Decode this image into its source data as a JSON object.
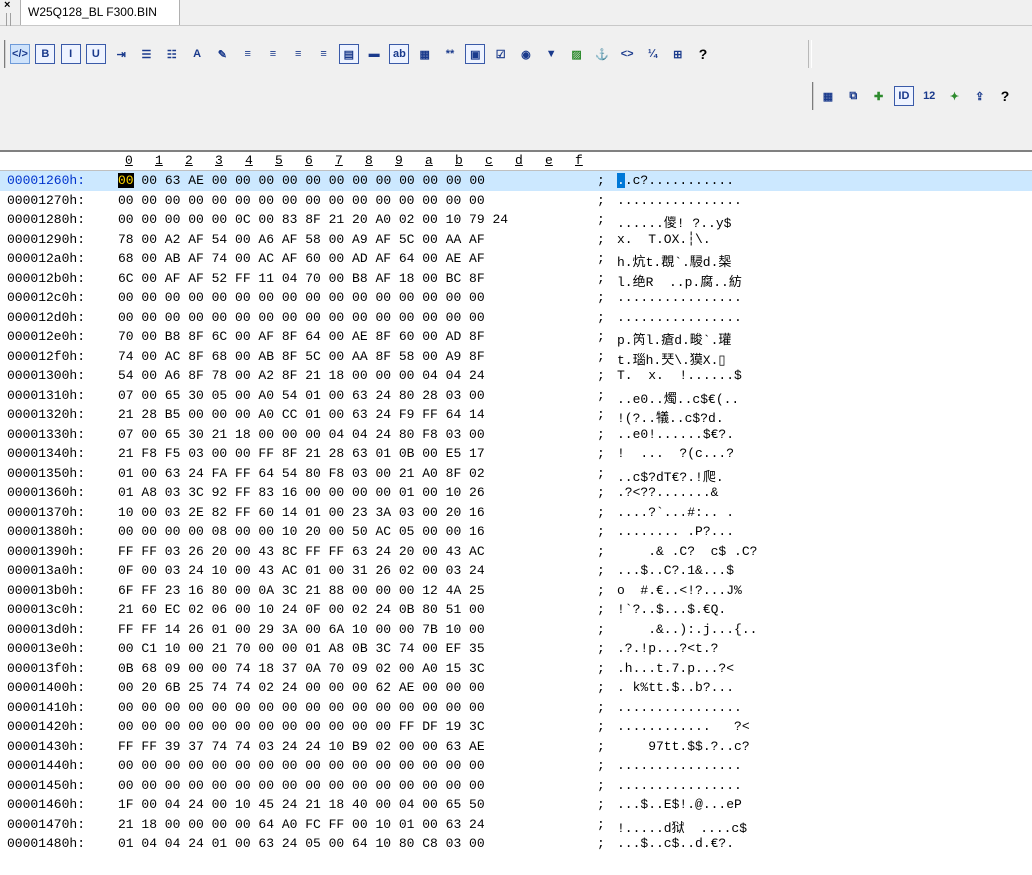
{
  "tab": {
    "close_glyph": "×",
    "title": "W25Q128_BL F300.BIN"
  },
  "toolbar1": [
    "source-view-icon",
    "bold-icon",
    "italic-icon",
    "underline-icon",
    "indent-icon",
    "bullet-list-icon",
    "numbered-list-icon",
    "font-color-icon",
    "highlight-icon",
    "align-left-icon",
    "align-center-icon",
    "align-right-icon",
    "justify-icon",
    "form-icon",
    "horizontal-rule-icon",
    "text-field-icon",
    "text-area-icon",
    "password-field-icon",
    "button-icon",
    "checkbox-icon",
    "radio-icon",
    "select-icon",
    "image-icon",
    "anchor-icon",
    "special-char-icon",
    "entity-icon",
    "table-icon",
    "help-icon"
  ],
  "toolbar1_help": "?",
  "toolbar2": [
    "table-grid-icon",
    "copy-icon",
    "insert-icon",
    "id-icon",
    "number-icon",
    "tools-icon",
    "export-icon",
    "help-icon"
  ],
  "toolbar2_help": "?",
  "column_header": [
    "0",
    "1",
    "2",
    "3",
    "4",
    "5",
    "6",
    "7",
    "8",
    "9",
    "a",
    "b",
    "c",
    "d",
    "e",
    "f"
  ],
  "cursor": {
    "row": 0,
    "byte": 0
  },
  "rows": [
    {
      "addr": "00001260h:",
      "bytes": "00 00 63 AE 00 00 00 00 00 00 00 00 00 00 00 00",
      "ascii": "..c?..........."
    },
    {
      "addr": "00001270h:",
      "bytes": "00 00 00 00 00 00 00 00 00 00 00 00 00 00 00 00",
      "ascii": "................"
    },
    {
      "addr": "00001280h:",
      "bytes": "00 00 00 00 00 0C 00 83 8F 21 20 A0 02 00 10 79 24",
      "ascii": "......儍! ?..y$"
    },
    {
      "addr": "00001290h:",
      "bytes": "78 00 A2 AF 54 00 A6 AF 58 00 A9 AF 5C 00 AA AF",
      "ascii": "x.  T.OX.┆\\."
    },
    {
      "addr": "000012a0h:",
      "bytes": "68 00 AB AF 74 00 AC AF 60 00 AD AF 64 00 AE AF",
      "ascii": "h.炕t.覠`.駸d.椝"
    },
    {
      "addr": "000012b0h:",
      "bytes": "6C 00 AF AF 52 FF 11 04 70 00 B8 AF 18 00 BC 8F",
      "ascii": "l.绝R  ..p.腐..紡"
    },
    {
      "addr": "000012c0h:",
      "bytes": "00 00 00 00 00 00 00 00 00 00 00 00 00 00 00 00",
      "ascii": "................"
    },
    {
      "addr": "000012d0h:",
      "bytes": "00 00 00 00 00 00 00 00 00 00 00 00 00 00 00 00",
      "ascii": "................"
    },
    {
      "addr": "000012e0h:",
      "bytes": "70 00 B8 8F 6C 00 AF 8F 64 00 AE 8F 60 00 AD 8F",
      "ascii": "p.笍l.瘡d.畯`.瓘"
    },
    {
      "addr": "000012f0h:",
      "bytes": "74 00 AC 8F 68 00 AB 8F 5C 00 AA 8F 58 00 A9 8F",
      "ascii": "t.瑙h.珡\\.獏X.▯"
    },
    {
      "addr": "00001300h:",
      "bytes": "54 00 A6 8F 78 00 A2 8F 21 18 00 00 00 04 04 24",
      "ascii": "T.  x.  !......$"
    },
    {
      "addr": "00001310h:",
      "bytes": "07 00 65 30 05 00 A0 54 01 00 63 24 80 28 03 00",
      "ascii": "..e0..燭..c$€(.."
    },
    {
      "addr": "00001320h:",
      "bytes": "21 28 B5 00 00 00 A0 CC 01 00 63 24 F9 FF 64 14",
      "ascii": "!(?..犠..c$?d."
    },
    {
      "addr": "00001330h:",
      "bytes": "07 00 65 30 21 18 00 00 00 04 04 24 80 F8 03 00",
      "ascii": "..e0!......$€?."
    },
    {
      "addr": "00001340h:",
      "bytes": "21 F8 F5 03 00 00 FF 8F 21 28 63 01 0B 00 E5 17",
      "ascii": "!  ...  ?(c...?"
    },
    {
      "addr": "00001350h:",
      "bytes": "01 00 63 24 FA FF 64 54 80 F8 03 00 21 A0 8F 02",
      "ascii": "..c$?dT€?.!爬."
    },
    {
      "addr": "00001360h:",
      "bytes": "01 A8 03 3C 92 FF 83 16 00 00 00 00 01 00 10 26",
      "ascii": ".?<??.......&"
    },
    {
      "addr": "00001370h:",
      "bytes": "10 00 03 2E 82 FF 60 14 01 00 23 3A 03 00 20 16",
      "ascii": "....?`...#:.. ."
    },
    {
      "addr": "00001380h:",
      "bytes": "00 00 00 00 08 00 00 10 20 00 50 AC 05 00 00 16",
      "ascii": "........ .P?..."
    },
    {
      "addr": "00001390h:",
      "bytes": "FF FF 03 26 20 00 43 8C FF FF 63 24 20 00 43 AC",
      "ascii": "    .& .C?  c$ .C?"
    },
    {
      "addr": "000013a0h:",
      "bytes": "0F 00 03 24 10 00 43 AC 01 00 31 26 02 00 03 24",
      "ascii": "...$..C?.1&...$"
    },
    {
      "addr": "000013b0h:",
      "bytes": "6F FF 23 16 80 00 0A 3C 21 88 00 00 00 12 4A 25",
      "ascii": "o  #.€..<!?...J%"
    },
    {
      "addr": "000013c0h:",
      "bytes": "21 60 EC 02 06 00 10 24 0F 00 02 24 0B 80 51 00",
      "ascii": "!`?..$...$.€Q."
    },
    {
      "addr": "000013d0h:",
      "bytes": "FF FF 14 26 01 00 29 3A 00 6A 10 00 00 7B 10 00",
      "ascii": "    .&..):.j...{.."
    },
    {
      "addr": "000013e0h:",
      "bytes": "00 C1 10 00 21 70 00 00 01 A8 0B 3C 74 00 EF 35",
      "ascii": ".?.!p...?<t.?"
    },
    {
      "addr": "000013f0h:",
      "bytes": "0B 68 09 00 00 74 18 37 0A 70 09 02 00 A0 15 3C",
      "ascii": ".h...t.7.p...?<"
    },
    {
      "addr": "00001400h:",
      "bytes": "00 20 6B 25 74 74 02 24 00 00 00 62 AE 00 00 00",
      "ascii": ". k%tt.$..b?..."
    },
    {
      "addr": "00001410h:",
      "bytes": "00 00 00 00 00 00 00 00 00 00 00 00 00 00 00 00",
      "ascii": "................"
    },
    {
      "addr": "00001420h:",
      "bytes": "00 00 00 00 00 00 00 00 00 00 00 00 FF DF 19 3C",
      "ascii": "............   ?<"
    },
    {
      "addr": "00001430h:",
      "bytes": "FF FF 39 37 74 74 03 24 24 10 B9 02 00 00 63 AE",
      "ascii": "    97tt.$$.?..c?"
    },
    {
      "addr": "00001440h:",
      "bytes": "00 00 00 00 00 00 00 00 00 00 00 00 00 00 00 00",
      "ascii": "................"
    },
    {
      "addr": "00001450h:",
      "bytes": "00 00 00 00 00 00 00 00 00 00 00 00 00 00 00 00",
      "ascii": "................"
    },
    {
      "addr": "00001460h:",
      "bytes": "1F 00 04 24 00 10 45 24 21 18 40 00 04 00 65 50",
      "ascii": "...$..E$!.@...eP"
    },
    {
      "addr": "00001470h:",
      "bytes": "21 18 00 00 00 00 64 A0 FC FF 00 10 01 00 63 24",
      "ascii": "!.....d狱  ....c$"
    },
    {
      "addr": "00001480h:",
      "bytes": "01 04 04 24 01 00 63 24 05 00 64 10 80 C8 03 00",
      "ascii": "...$..c$..d.€?."
    }
  ]
}
